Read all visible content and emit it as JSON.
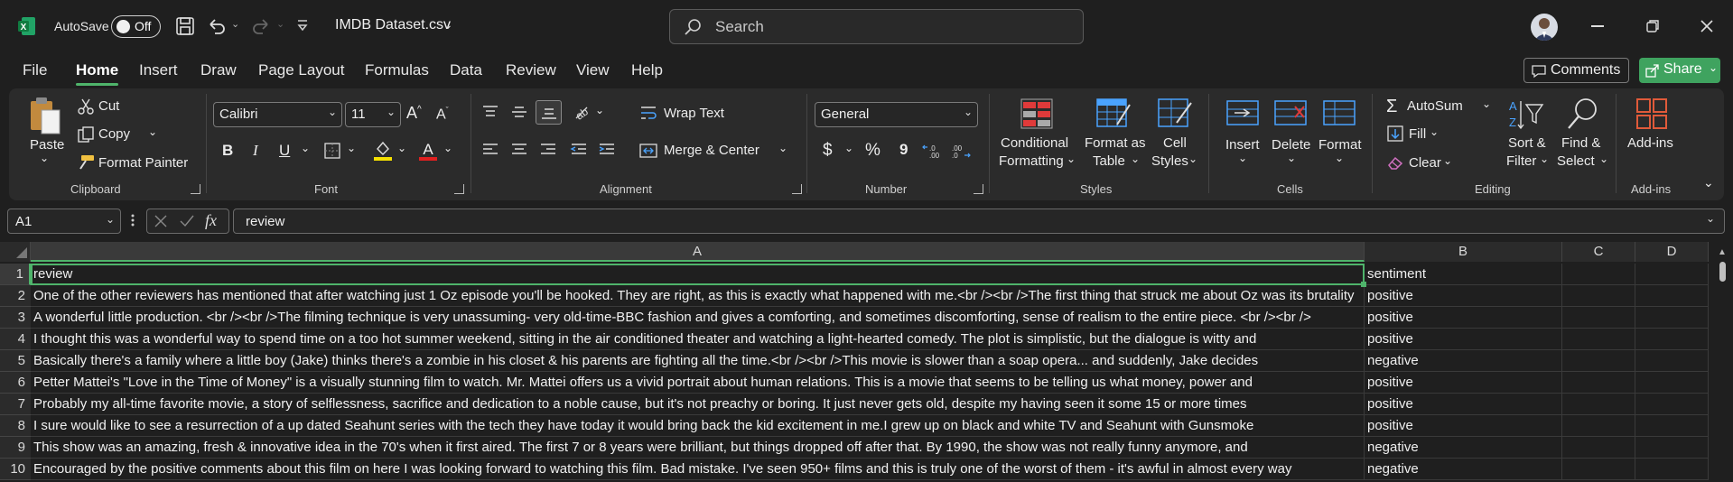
{
  "title_bar": {
    "autosave_label": "AutoSave",
    "autosave_state": "Off",
    "file_name": "IMDB Dataset.csv",
    "search_placeholder": "Search"
  },
  "menu": {
    "tabs": [
      "File",
      "Home",
      "Insert",
      "Draw",
      "Page Layout",
      "Formulas",
      "Data",
      "Review",
      "View",
      "Help"
    ],
    "active_tab": "Home",
    "comments_label": "Comments",
    "share_label": "Share"
  },
  "ribbon": {
    "clipboard": {
      "paste": "Paste",
      "cut": "Cut",
      "copy": "Copy",
      "format_painter": "Format Painter",
      "group": "Clipboard"
    },
    "font": {
      "name": "Calibri",
      "size": "11",
      "bold": "B",
      "italic": "I",
      "underline": "U",
      "group": "Font"
    },
    "alignment": {
      "wrap_text": "Wrap Text",
      "merge_center": "Merge & Center",
      "group": "Alignment"
    },
    "number": {
      "format": "General",
      "currency": "$",
      "percent": "%",
      "comma": "9",
      "group": "Number"
    },
    "styles": {
      "conditional_1": "Conditional",
      "conditional_2": "Formatting",
      "format_table_1": "Format as",
      "format_table_2": "Table",
      "cell_styles_1": "Cell",
      "cell_styles_2": "Styles",
      "group": "Styles"
    },
    "cells": {
      "insert": "Insert",
      "delete": "Delete",
      "format": "Format",
      "group": "Cells"
    },
    "editing": {
      "autosum": "AutoSum",
      "fill": "Fill",
      "clear": "Clear",
      "sort_1": "Sort &",
      "sort_2": "Filter",
      "find_1": "Find &",
      "find_2": "Select",
      "group": "Editing"
    },
    "addins": {
      "label": "Add-ins",
      "group": "Add-ins"
    }
  },
  "formula_bar": {
    "name_box": "A1",
    "fx": "fx",
    "content": "review"
  },
  "grid": {
    "columns": [
      "A",
      "B",
      "C",
      "D"
    ],
    "rows": [
      {
        "n": "1",
        "a": "review",
        "b": "sentiment"
      },
      {
        "n": "2",
        "a": "One of the other reviewers has mentioned that after watching just 1 Oz episode you'll be hooked. They are right, as this is exactly what happened with me.<br /><br />The first thing that struck me about Oz was its brutality",
        "b": "positive"
      },
      {
        "n": "3",
        "a": "A wonderful little production. <br /><br />The filming technique is very unassuming- very old-time-BBC fashion and gives a comforting, and sometimes discomforting, sense of realism to the entire piece. <br /><br />",
        "b": "positive"
      },
      {
        "n": "4",
        "a": "I thought this was a wonderful way to spend time on a too hot summer weekend, sitting in the air conditioned theater and watching a light-hearted comedy. The plot is simplistic, but the dialogue is witty and",
        "b": "positive"
      },
      {
        "n": "5",
        "a": "Basically there's a family where a little boy (Jake) thinks there's a zombie in his closet & his parents are fighting all the time.<br /><br />This movie is slower than a soap opera... and suddenly, Jake decides",
        "b": "negative"
      },
      {
        "n": "6",
        "a": "Petter Mattei's \"Love in the Time of Money\" is a visually stunning film to watch. Mr. Mattei offers us a vivid portrait about human relations. This is a movie that seems to be telling us what money, power and",
        "b": "positive"
      },
      {
        "n": "7",
        "a": "Probably my all-time favorite movie, a story of selflessness, sacrifice and dedication to a noble cause, but it's not preachy or boring. It just never gets old, despite my having seen it some 15 or more times",
        "b": "positive"
      },
      {
        "n": "8",
        "a": "I sure would like to see a resurrection of a up dated Seahunt series with the tech they have today it would bring back the kid excitement in me.I grew up on black and white TV and Seahunt with Gunsmoke",
        "b": "positive"
      },
      {
        "n": "9",
        "a": "This show was an amazing, fresh & innovative idea in the 70's when it first aired. The first 7 or 8 years were brilliant, but things dropped off after that. By 1990, the show was not really funny anymore, and",
        "b": "negative"
      },
      {
        "n": "10",
        "a": "Encouraged by the positive comments about this film on here I was looking forward to watching this film. Bad mistake. I've seen 950+ films and this is truly one of the worst of them - it's awful in almost every way",
        "b": "negative"
      }
    ]
  },
  "colors": {
    "accent": "#4fb46b",
    "excel_green": "#107c41",
    "share_bg": "#3fa35f"
  }
}
